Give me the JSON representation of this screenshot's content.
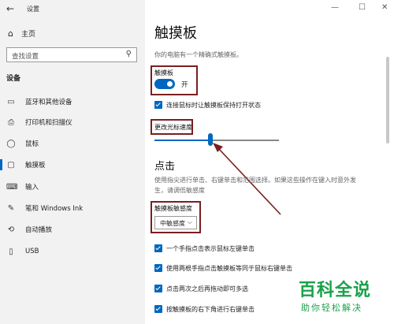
{
  "window": {
    "title": "设置",
    "controls": [
      "—",
      "☐",
      "✕"
    ]
  },
  "sidebar": {
    "home_label": "主页",
    "search_placeholder": "查找设置",
    "section_title": "设备",
    "items": [
      {
        "label": "蓝牙和其他设备",
        "icon": "bluetooth-devices-icon",
        "glyph": "▭"
      },
      {
        "label": "打印机和扫描仪",
        "icon": "printer-icon",
        "glyph": "⎙"
      },
      {
        "label": "鼠标",
        "icon": "mouse-icon",
        "glyph": "◯"
      },
      {
        "label": "触摸板",
        "icon": "touchpad-icon",
        "glyph": "▢"
      },
      {
        "label": "输入",
        "icon": "keyboard-icon",
        "glyph": "⌨"
      },
      {
        "label": "笔和 Windows Ink",
        "icon": "pen-icon",
        "glyph": "✎"
      },
      {
        "label": "自动播放",
        "icon": "autoplay-icon",
        "glyph": "⟲"
      },
      {
        "label": "USB",
        "icon": "usb-icon",
        "glyph": "▯"
      }
    ],
    "active_index": 3
  },
  "main": {
    "title": "触摸板",
    "description": "你的电脑有一个精确式触摸板。",
    "touchpad_label": "触摸板",
    "toggle_state": "开",
    "keep_on_label": "连接鼠标时让触摸板保持打开状态",
    "cursor_speed_label": "更改光标速度",
    "cursor_speed_value": 0.45,
    "tap_title": "点击",
    "tap_description": "使用指尖进行单击、右键单击和范围选择。如果这些操作在键入时意外发生，请调低敏感度",
    "sensitivity_label": "触摸板敏感度",
    "sensitivity_value": "中敏感度",
    "checkboxes": [
      "一个手指点击表示鼠标左键单击",
      "使用两根手指点击触摸板等同于鼠标右键单击",
      "点击两次之后再拖动即可多选",
      "按触摸板的右下角进行右键单击"
    ]
  },
  "watermark": {
    "title": "百科全说",
    "subtitle": "助你轻松解决"
  },
  "colors": {
    "accent": "#0067c0",
    "annotation": "#7a1f1f",
    "watermark": "#1aa14a"
  }
}
